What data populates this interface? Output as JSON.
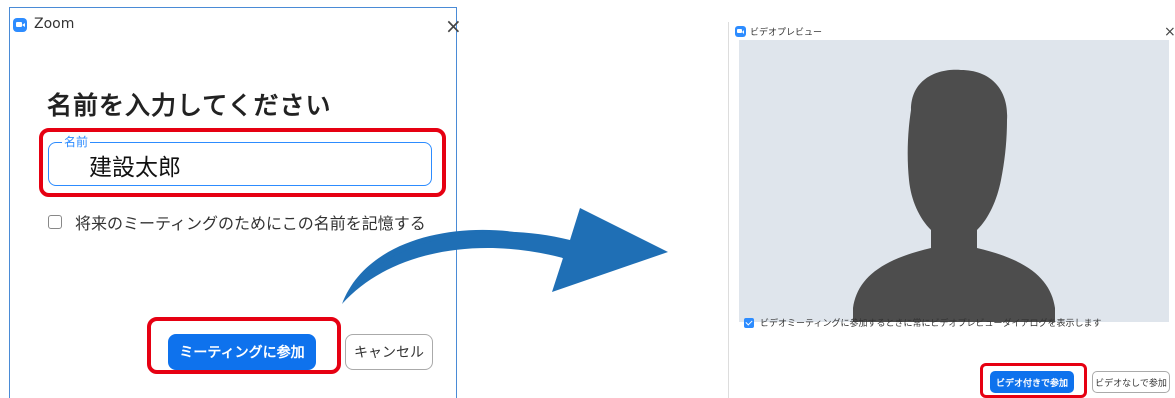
{
  "left_dialog": {
    "title": "Zoom",
    "close_icon": "×",
    "heading": "名前を入力してください",
    "name_field": {
      "label": "名前",
      "value": "建設太郎"
    },
    "remember_label": "将来のミーティングのためにこの名前を記憶する",
    "join_button": "ミーティングに参加",
    "cancel_button": "キャンセル"
  },
  "right_dialog": {
    "title": "ビデオプレビュー",
    "close_icon": "×",
    "always_show_label": "ビデオミーティングに参加するときに常にビデオプレビューダイアログを表示します",
    "join_with_video_button": "ビデオ付きで参加",
    "join_without_video_button": "ビデオなしで参加"
  },
  "colors": {
    "accent": "#0e72ed",
    "highlight": "#e60012",
    "arrow": "#1f6fb5",
    "preview_bg": "#dfe5ec",
    "silhouette": "#4d4d4d"
  }
}
